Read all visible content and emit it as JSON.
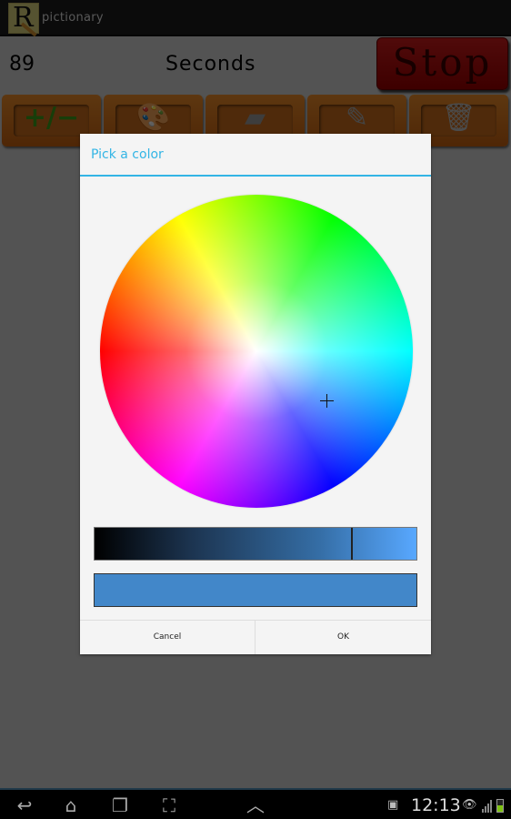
{
  "app": {
    "title": "pictionary",
    "icon_letter": "R"
  },
  "header": {
    "timer_value": "89",
    "timer_label": "Seconds",
    "stop_label": "Stop"
  },
  "toolbar": {
    "tools": [
      {
        "name": "brush-size",
        "icon": "plus-minus-icon",
        "glyph": "+/−"
      },
      {
        "name": "color-palette",
        "icon": "palette-icon",
        "glyph": "🎨"
      },
      {
        "name": "eraser",
        "icon": "eraser-icon",
        "glyph": "▰"
      },
      {
        "name": "pencil",
        "icon": "pencil-icon",
        "glyph": "✎"
      },
      {
        "name": "clear",
        "icon": "trash-icon",
        "glyph": "🗑"
      }
    ]
  },
  "dialog": {
    "title": "Pick a color",
    "wheel_hue_deg": 215,
    "wheel_saturation": 0.55,
    "brightness_value": 0.8,
    "selected_color": "#4287c9",
    "cancel_label": "Cancel",
    "ok_label": "OK",
    "accent_color": "#33b5e5"
  },
  "navbar": {
    "buttons": [
      "back-icon",
      "home-icon",
      "recent-apps-icon",
      "screenshot-icon",
      "chevron-up-icon"
    ],
    "clock": "12:13",
    "status_icons": [
      "gallery-icon",
      "eye-icon",
      "signal-icon",
      "battery-icon"
    ]
  }
}
